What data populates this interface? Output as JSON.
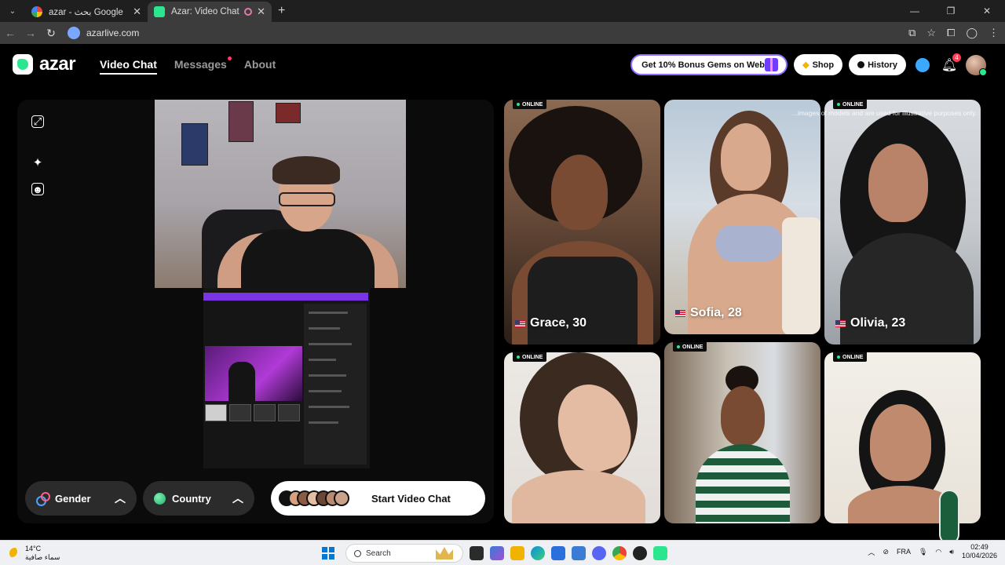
{
  "browser": {
    "tabs": [
      {
        "title": "azar - بحث Google",
        "active": false
      },
      {
        "title": "Azar: Video Chat with New",
        "active": true
      }
    ],
    "url": "azarlive.com"
  },
  "header": {
    "logo_text": "azar",
    "nav": [
      {
        "label": "Video Chat",
        "active": true
      },
      {
        "label": "Messages",
        "active": false,
        "dot": true
      },
      {
        "label": "About",
        "active": false
      }
    ],
    "promo_label": "Get 10% Bonus Gems on Web!",
    "shop_label": "Shop",
    "history_label": "History",
    "notification_count": "4"
  },
  "controls": {
    "gender_label": "Gender",
    "country_label": "Country",
    "start_label": "Start Video Chat"
  },
  "disclaimer": "...images of models and are used for illustrative purposes only.",
  "profiles": [
    {
      "name": "Grace, 30",
      "online": "ONLINE",
      "country": "US"
    },
    {
      "name": "Sofia, 28",
      "online": "",
      "country": "US"
    },
    {
      "name": "Olivia, 23",
      "online": "ONLINE",
      "country": "US"
    },
    {
      "name": "",
      "online": "ONLINE",
      "country": ""
    },
    {
      "name": "",
      "online": "ONLINE",
      "country": ""
    },
    {
      "name": "",
      "online": "ONLINE",
      "country": ""
    }
  ],
  "taskbar": {
    "weather_temp": "14°C",
    "weather_desc": "سماء صافية",
    "search_placeholder": "Search",
    "language": "FRA",
    "time": "02:49",
    "date": "10/04/2026"
  },
  "colors": {
    "accent_green": "#2be58f",
    "brand_purple": "#8f6bff",
    "notification_red": "#ff3b55"
  }
}
